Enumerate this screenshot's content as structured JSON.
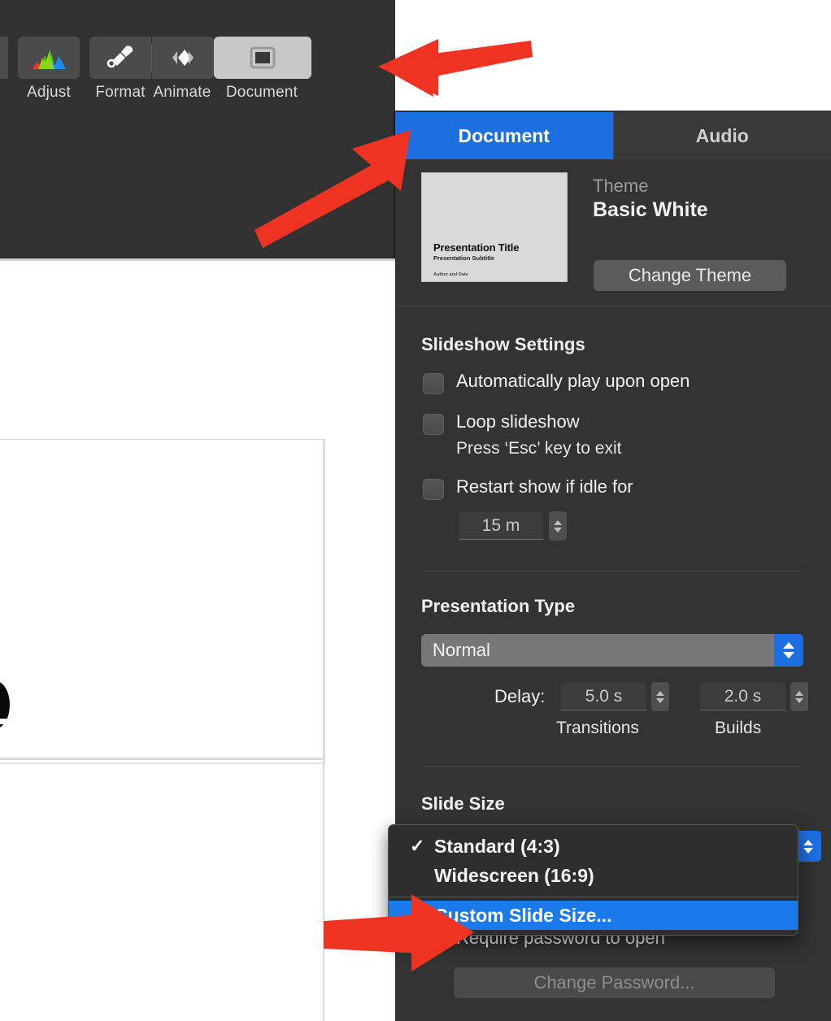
{
  "toolbar": {
    "buttons": [
      {
        "label": "Adjust",
        "icon": "histogram-icon",
        "selected": false
      },
      {
        "label": "Format",
        "icon": "paintbrush-icon",
        "selected": false
      },
      {
        "label": "Animate",
        "icon": "diamond-icon",
        "selected": false
      },
      {
        "label": "Document",
        "icon": "document-icon",
        "selected": true
      }
    ]
  },
  "inspector": {
    "tabs": [
      {
        "label": "Document",
        "active": true
      },
      {
        "label": "Audio",
        "active": false
      }
    ],
    "theme": {
      "section_label": "Theme",
      "name": "Basic White",
      "change_button": "Change Theme",
      "thumbnail": {
        "title": "Presentation Title",
        "subtitle": "Presentation Subtitle",
        "author": "Author and Date"
      }
    },
    "slideshow": {
      "title": "Slideshow Settings",
      "auto_play": "Automatically play upon open",
      "loop": "Loop slideshow",
      "loop_hint": "Press ‘Esc’ key to exit",
      "restart": "Restart show if idle for",
      "idle_value": "15 m"
    },
    "presentation_type": {
      "title": "Presentation Type",
      "value": "Normal",
      "delay_label": "Delay:",
      "transitions_value": "5.0 s",
      "transitions_label": "Transitions",
      "builds_value": "2.0 s",
      "builds_label": "Builds"
    },
    "slide_size": {
      "title": "Slide Size",
      "menu_items": [
        {
          "label": "Standard (4:3)",
          "checked": true,
          "highlighted": false,
          "check_glyph": "✓"
        },
        {
          "label": "Widescreen (16:9)",
          "checked": false,
          "highlighted": false,
          "check_glyph": ""
        },
        {
          "label": "Custom Slide Size...",
          "checked": false,
          "highlighted": true,
          "check_glyph": ""
        }
      ]
    },
    "password": {
      "require_label": "Require password to open",
      "change_button": "Change Password..."
    }
  },
  "annotations": {
    "arrow_color": "#ee3322",
    "arrows": [
      {
        "name": "arrow-to-document-button",
        "points_to": "Document"
      },
      {
        "name": "arrow-to-document-tab",
        "points_to": "Document tab"
      },
      {
        "name": "arrow-to-custom-slide-size",
        "points_to": "Custom Slide Size..."
      }
    ]
  },
  "colors": {
    "accent_blue": "#1d6fe0",
    "panel_bg": "#333333",
    "toolbar_bg": "#323232",
    "menu_highlight": "#1a7aea"
  }
}
